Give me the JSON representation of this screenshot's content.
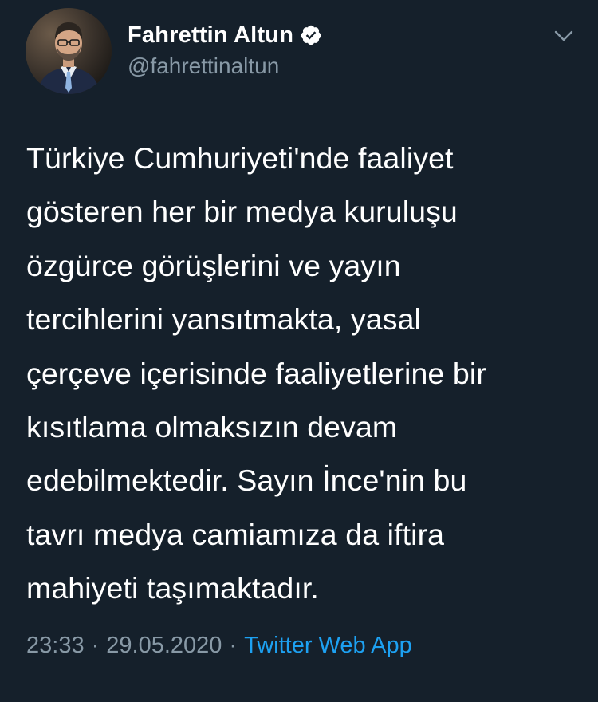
{
  "tweet": {
    "author": {
      "display_name": "Fahrettin Altun",
      "handle": "@fahrettinaltun",
      "verified": true,
      "avatar_icon": "profile-photo"
    },
    "text": "Türkiye Cumhuriyeti'nde faaliyet\ngösteren her bir medya kuruluşu\nözgürce görüşlerini ve yayın\ntercihlerini yansıtmakta, yasal\nçerçeve içerisinde faaliyetlerine bir\nkısıtlama olmaksızın devam\nedebilmektedir. Sayın İnce'nin bu\ntavrı medya camiamıza da iftira\nmahiyeti taşımaktadır.",
    "time": "23:33",
    "separator": "·",
    "date": "29.05.2020",
    "source": "Twitter Web App"
  },
  "colors": {
    "background": "#15202b",
    "text": "#ffffff",
    "secondary_text": "#8899a6",
    "link": "#1da1f2",
    "divider": "#38444d"
  },
  "icons": {
    "verified": "verified-badge-icon",
    "menu": "chevron-down-icon"
  }
}
